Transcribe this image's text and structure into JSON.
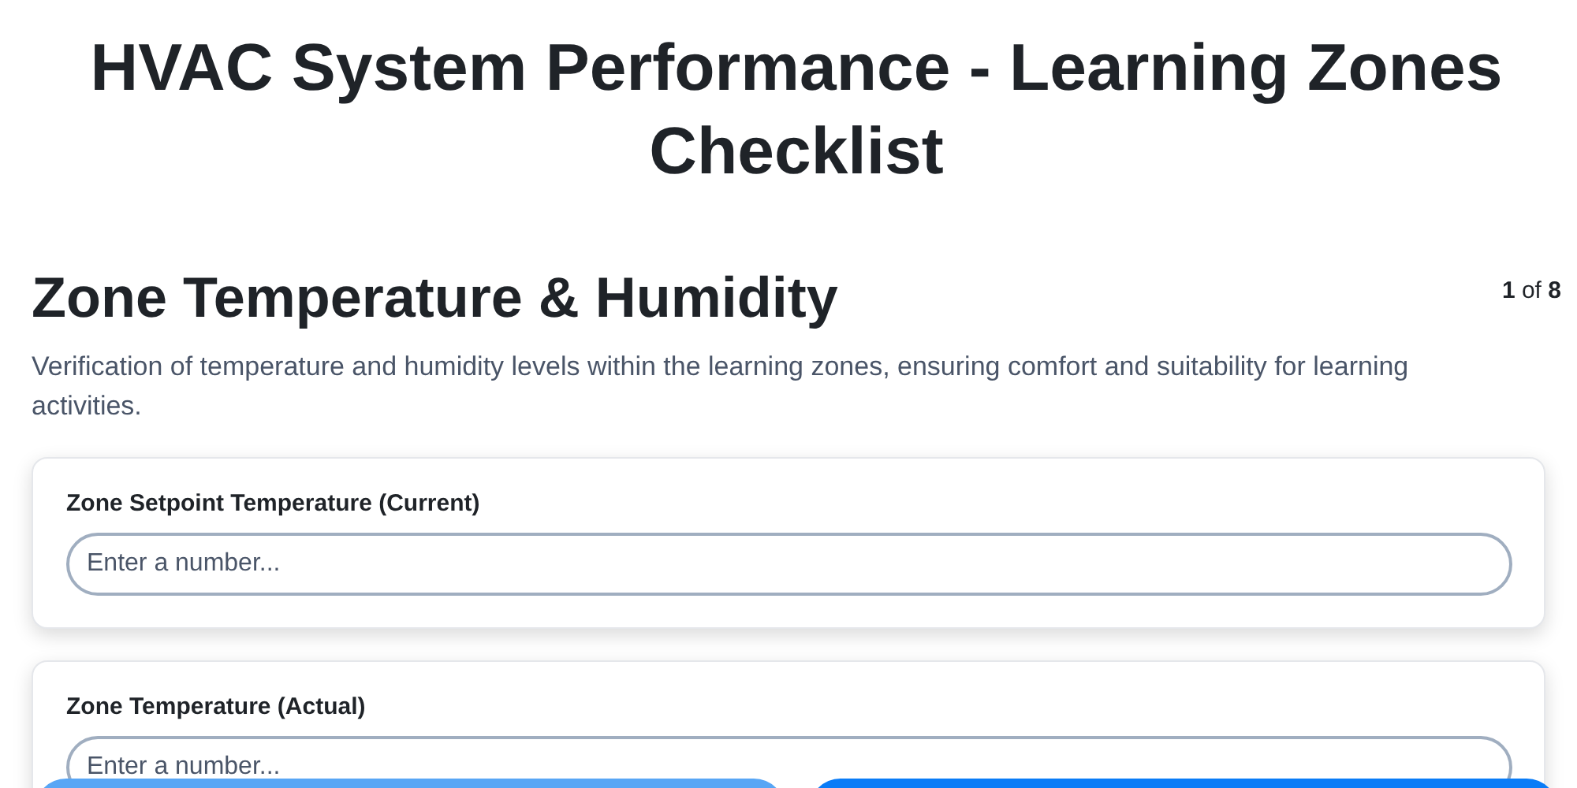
{
  "title": "HVAC System Performance - Learning Zones Checklist",
  "section": {
    "heading": "Zone Temperature & Humidity",
    "counter": "**1** of **8**",
    "description": "Verification of temperature and humidity levels within the learning zones, ensuring comfort and suitability for learning activities."
  },
  "fields": [
    {
      "label": "Zone Setpoint Temperature (Current)",
      "placeholder": "Enter a number..."
    },
    {
      "label": "Zone Temperature (Actual)",
      "placeholder": "Enter a number..."
    }
  ],
  "footer_buttons": [
    {
      "kind": "secondary"
    },
    {
      "kind": "primary"
    }
  ]
}
